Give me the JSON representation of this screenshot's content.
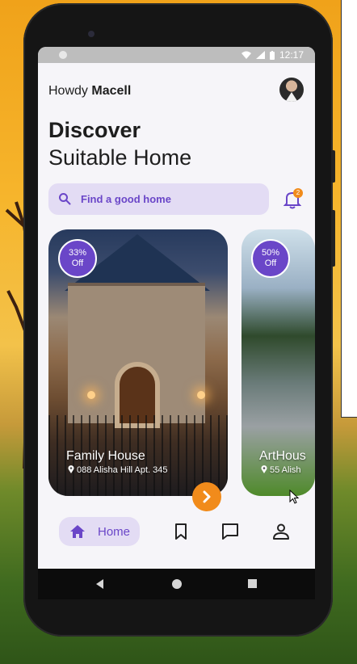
{
  "status_bar": {
    "time": "12:17"
  },
  "header": {
    "greeting": "Howdy",
    "user_name": "Macell"
  },
  "hero": {
    "line1": "Discover",
    "line2": "Suitable Home"
  },
  "search": {
    "placeholder": "Find a good home"
  },
  "notifications": {
    "count": "2"
  },
  "cards": [
    {
      "discount_line1": "33%",
      "discount_line2": "Off",
      "title": "Family House",
      "address": "088 Alisha Hill Apt. 345"
    },
    {
      "discount_line1": "50%",
      "discount_line2": "Off",
      "title": "ArtHous",
      "address": "55 Alish"
    }
  ],
  "nav": {
    "home_label": "Home"
  },
  "colors": {
    "accent": "#6a46c8",
    "accent_light": "#e3dcf4",
    "orange": "#f18b1b"
  }
}
